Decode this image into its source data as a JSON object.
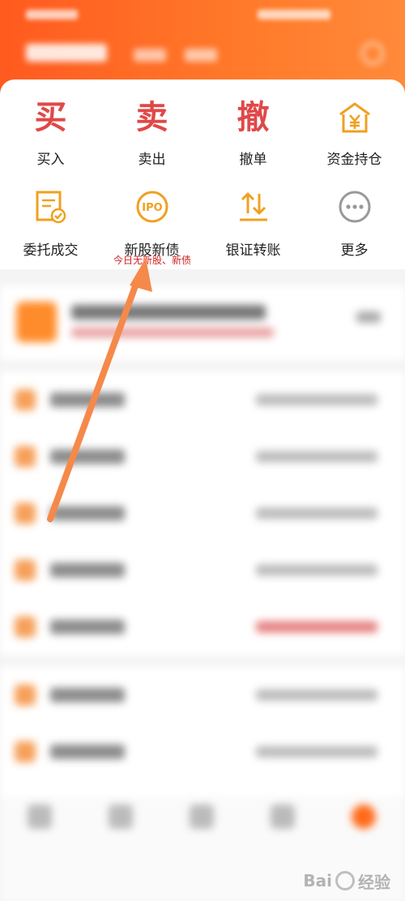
{
  "trade_menu": {
    "row1": [
      {
        "char": "买",
        "label": "买入"
      },
      {
        "char": "卖",
        "label": "卖出"
      },
      {
        "char": "撤",
        "label": "撤单"
      },
      {
        "icon": "yuan-building-icon",
        "label": "资金持仓"
      }
    ],
    "row2": [
      {
        "icon": "document-check-icon",
        "label": "委托成交"
      },
      {
        "icon": "ipo-icon",
        "icon_text": "IPO",
        "label": "新股新债",
        "note": "今日无新股、新债"
      },
      {
        "icon": "transfer-arrows-icon",
        "label": "银证转账"
      },
      {
        "icon": "more-dots-icon",
        "label": "更多"
      }
    ]
  },
  "colors": {
    "accent": "#ff6a1a",
    "trade_red": "#e04848",
    "icon_orange": "#f0a020",
    "note_red": "#d22222"
  },
  "watermark": {
    "text": "Bai",
    "suffix": "经验"
  }
}
